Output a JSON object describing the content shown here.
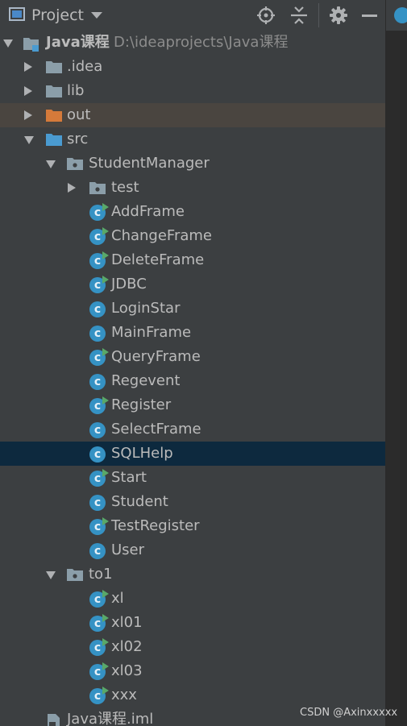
{
  "header": {
    "title": "Project",
    "icons": [
      "window-icon",
      "dropdown-icon",
      "locate-icon",
      "collapse-all-icon",
      "gear-icon",
      "minimize-icon"
    ]
  },
  "tree": {
    "root": {
      "label": "Java课程",
      "path": "D:\\ideaprojects\\Java课程"
    },
    "idea": {
      "label": ".idea"
    },
    "lib": {
      "label": "lib"
    },
    "out": {
      "label": "out"
    },
    "src": {
      "label": "src"
    },
    "student_manager": {
      "label": "StudentManager"
    },
    "test_pkg": {
      "label": "test"
    },
    "classes": [
      {
        "label": "AddFrame",
        "runnable": true
      },
      {
        "label": "ChangeFrame",
        "runnable": true
      },
      {
        "label": "DeleteFrame",
        "runnable": true
      },
      {
        "label": "JDBC",
        "runnable": true
      },
      {
        "label": "LoginStar",
        "runnable": false
      },
      {
        "label": "MainFrame",
        "runnable": false
      },
      {
        "label": "QueryFrame",
        "runnable": true
      },
      {
        "label": "Regevent",
        "runnable": false
      },
      {
        "label": "Register",
        "runnable": true
      },
      {
        "label": "SelectFrame",
        "runnable": false
      },
      {
        "label": "SQLHelp",
        "runnable": false
      },
      {
        "label": "Start",
        "runnable": true
      },
      {
        "label": "Student",
        "runnable": false
      },
      {
        "label": "TestRegister",
        "runnable": true
      },
      {
        "label": "User",
        "runnable": false
      }
    ],
    "to1": {
      "label": "to1"
    },
    "to1_classes": [
      {
        "label": "xl",
        "runnable": true
      },
      {
        "label": "xl01",
        "runnable": true
      },
      {
        "label": "xl02",
        "runnable": true
      },
      {
        "label": "xl03",
        "runnable": true
      },
      {
        "label": "xxx",
        "runnable": true
      }
    ],
    "iml": {
      "label": "Java课程.iml"
    },
    "selected": "SQLHelp"
  },
  "watermark": "CSDN @Axinxxxxx",
  "colors": {
    "background": "#3c3f41",
    "selection": "#0d293e",
    "excluded_folder_highlight": "#4a4540",
    "class_icon": "#3592c4",
    "run_badge": "#59a869",
    "folder_gray": "#8b9ea9",
    "folder_orange": "#d57a3a",
    "source_folder_blue": "#4a9bd1"
  }
}
